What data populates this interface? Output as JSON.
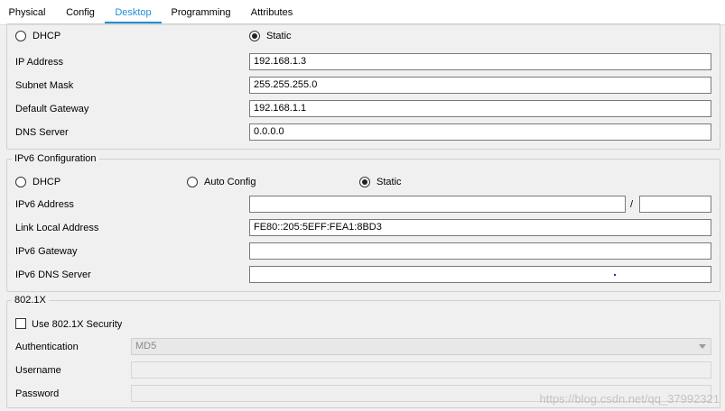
{
  "tabs": [
    {
      "label": "Physical",
      "active": false
    },
    {
      "label": "Config",
      "active": false
    },
    {
      "label": "Desktop",
      "active": true
    },
    {
      "label": "Programming",
      "active": false
    },
    {
      "label": "Attributes",
      "active": false
    }
  ],
  "ipv4": {
    "dhcp_label": "DHCP",
    "static_label": "Static",
    "mode": "static",
    "ip_label": "IP Address",
    "ip_value": "192.168.1.3",
    "mask_label": "Subnet Mask",
    "mask_value": "255.255.255.0",
    "gateway_label": "Default Gateway",
    "gateway_value": "192.168.1.1",
    "dns_label": "DNS Server",
    "dns_value": "0.0.0.0"
  },
  "ipv6": {
    "title": "IPv6 Configuration",
    "dhcp_label": "DHCP",
    "auto_label": "Auto Config",
    "static_label": "Static",
    "mode": "static",
    "address_label": "IPv6 Address",
    "address_value": "",
    "prefix_sep": "/",
    "prefix_value": "",
    "link_local_label": "Link Local Address",
    "link_local_value": "FE80::205:5EFF:FEA1:8BD3",
    "gateway_label": "IPv6 Gateway",
    "gateway_value": "",
    "dns_label": "IPv6 DNS Server",
    "dns_value": ""
  },
  "dot1x": {
    "title": "802.1X",
    "use_label": "Use 802.1X Security",
    "use_checked": false,
    "auth_label": "Authentication",
    "auth_value": "MD5",
    "username_label": "Username",
    "username_value": "",
    "password_label": "Password",
    "password_value": ""
  },
  "watermark": "https://blog.csdn.net/qq_37992321",
  "colors": {
    "accent": "#1e8fd6",
    "background": "#f0f0f0"
  }
}
